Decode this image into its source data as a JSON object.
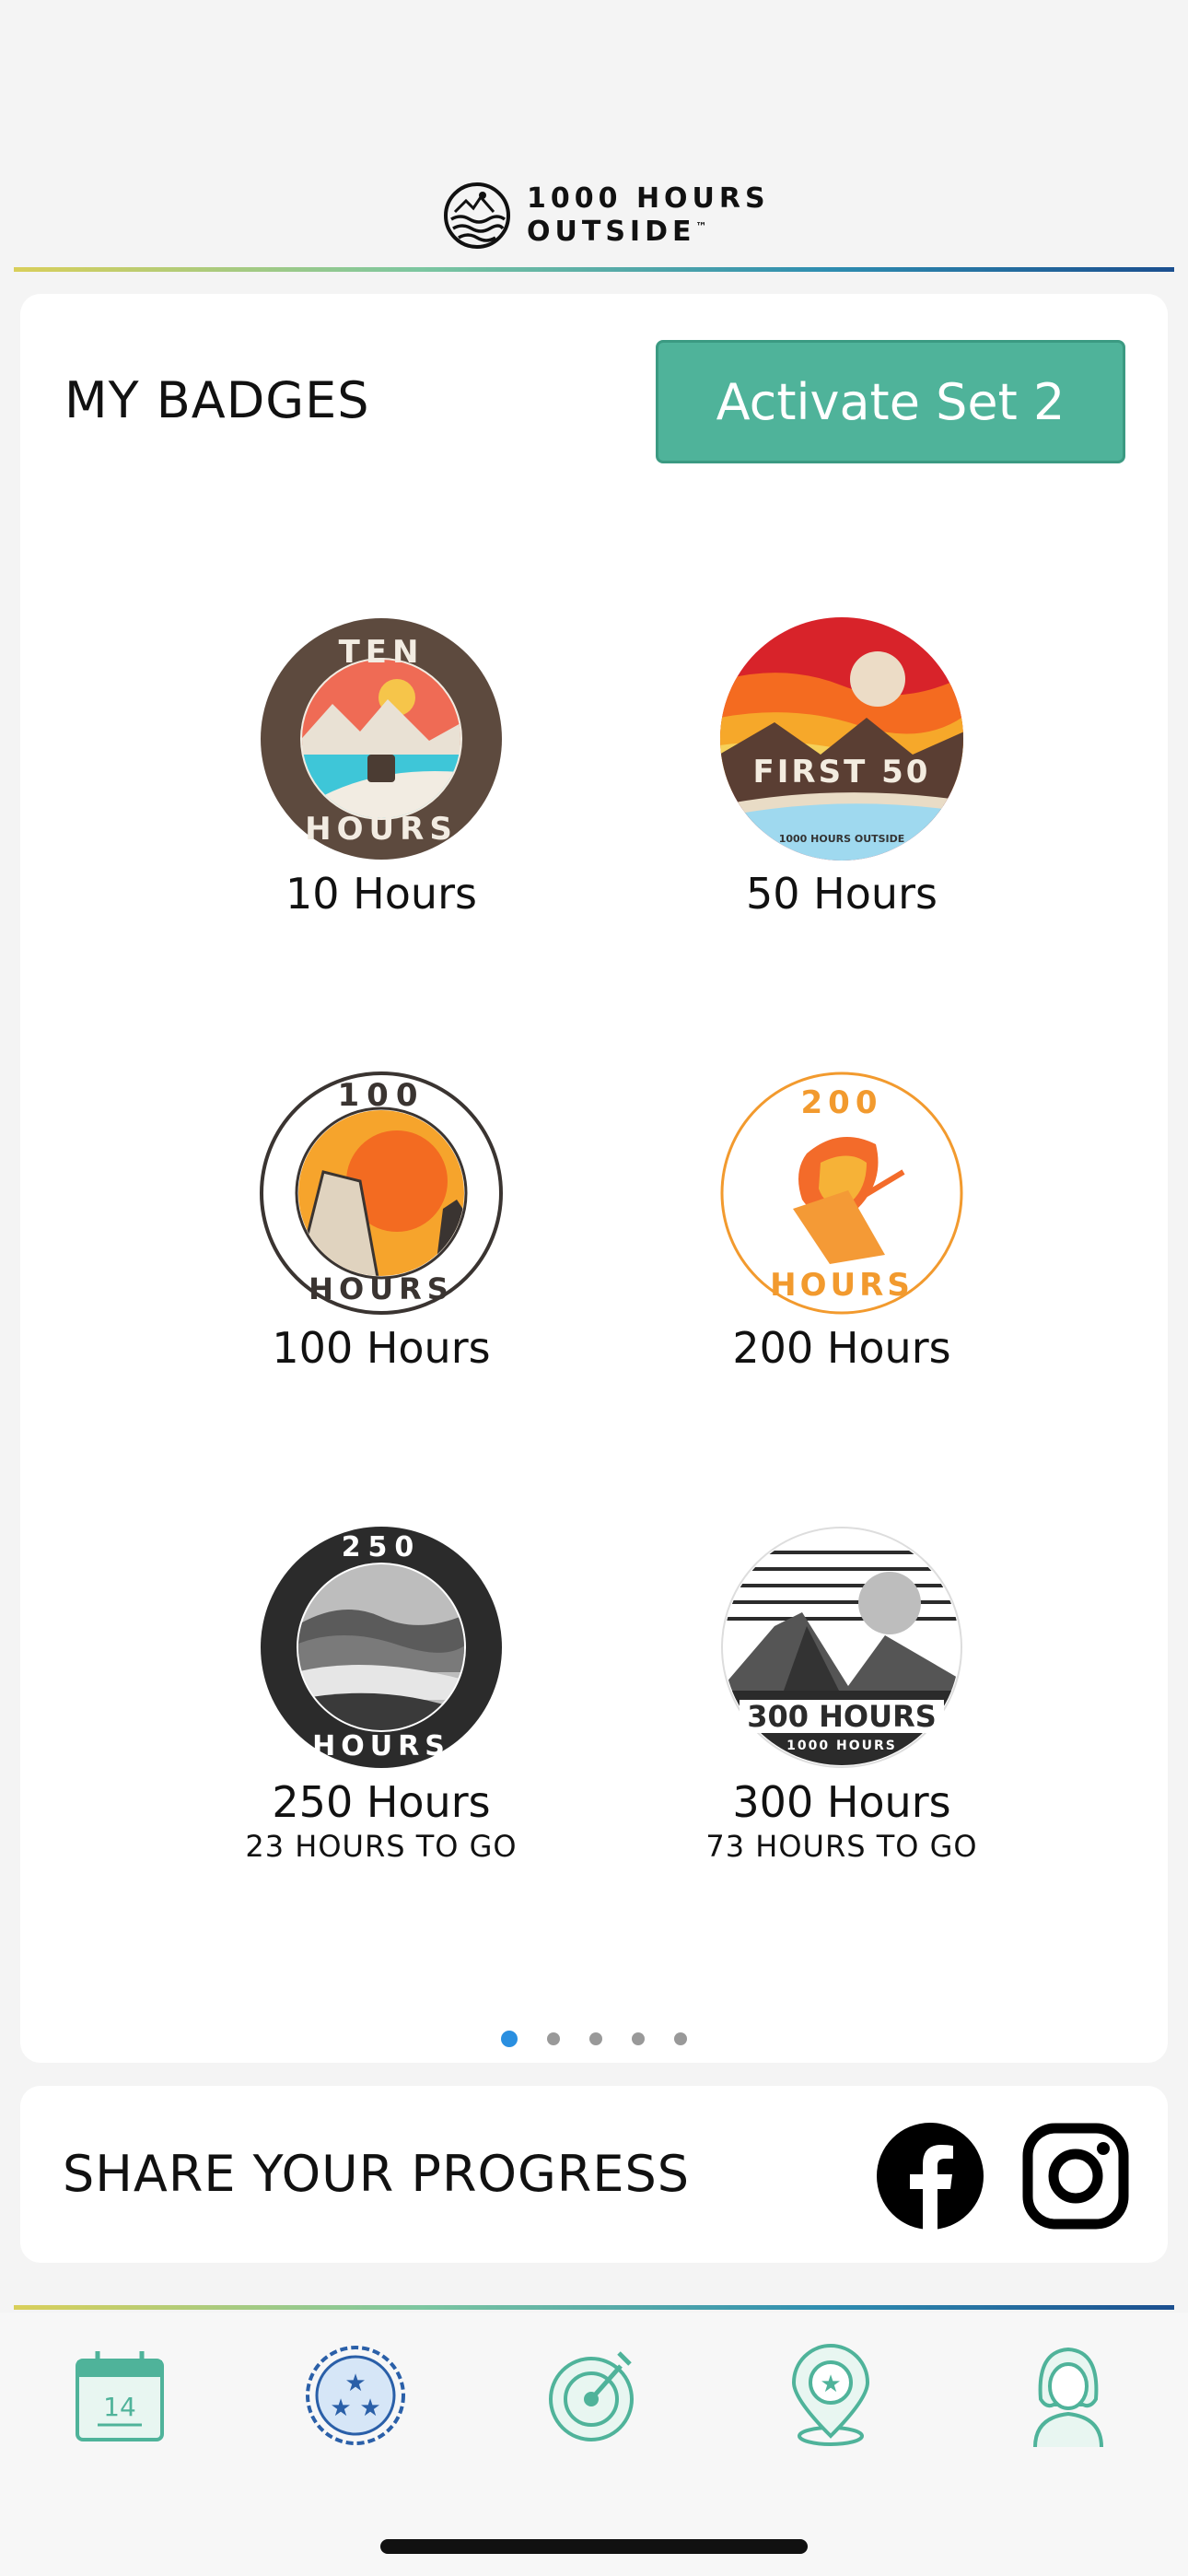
{
  "header": {
    "logo_line1": "1000 HOURS",
    "logo_line2": "OUTSIDE"
  },
  "badges_section": {
    "title": "MY BADGES",
    "activate_button": "Activate Set 2",
    "badges": [
      {
        "label": "10 Hours",
        "art_text_top": "TEN",
        "art_text_bottom": "HOURS",
        "remaining": ""
      },
      {
        "label": "50 Hours",
        "art_text_top": "FIRST 50",
        "art_text_bottom": "1000 HOURS OUTSIDE",
        "remaining": ""
      },
      {
        "label": "100 Hours",
        "art_text_top": "100",
        "art_text_bottom": "HOURS",
        "remaining": ""
      },
      {
        "label": "200 Hours",
        "art_text_top": "200",
        "art_text_bottom": "HOURS",
        "remaining": ""
      },
      {
        "label": "250 Hours",
        "art_text_top": "250",
        "art_text_bottom": "HOURS",
        "remaining": "23 HOURS TO GO"
      },
      {
        "label": "300 Hours",
        "art_text_top": "300 HOURS",
        "art_text_bottom": "1000 HOURS",
        "remaining": "73 HOURS TO GO"
      }
    ],
    "pages": 5,
    "active_page": 1
  },
  "share_section": {
    "title": "SHARE YOUR PROGRESS",
    "icons": [
      "facebook-icon",
      "instagram-icon"
    ]
  },
  "bottom_nav": {
    "calendar_day": "14",
    "items": [
      "calendar-icon",
      "badges-icon",
      "timer-icon",
      "map-pin-icon",
      "profile-icon"
    ],
    "accent_color": "#4fb39a",
    "active_color": "#2a5fa8"
  },
  "colors": {
    "activate_button": "#4fb39a",
    "active_dot": "#2a8fe0"
  }
}
